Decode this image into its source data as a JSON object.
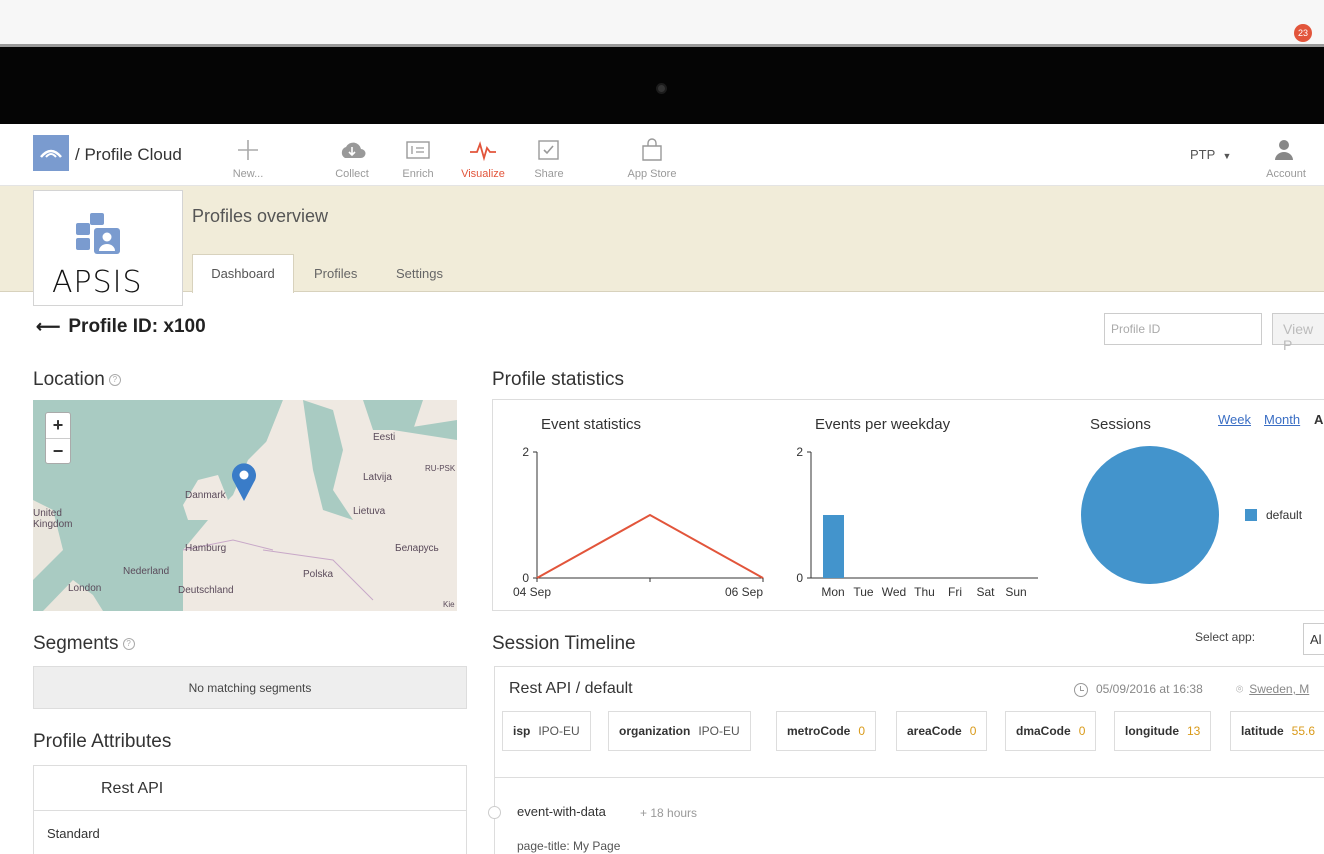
{
  "app": {
    "brand": "/ Profile Cloud",
    "apsis_word": "APSIS"
  },
  "toolbar": {
    "items": [
      {
        "label": "New...",
        "icon": "plus-icon"
      },
      {
        "label": "Collect",
        "icon": "cloud-icon"
      },
      {
        "label": "Enrich",
        "icon": "enrich-icon"
      },
      {
        "label": "Visualize",
        "icon": "pulse-icon"
      },
      {
        "label": "Share",
        "icon": "share-icon"
      },
      {
        "label": "App Store",
        "icon": "bag-icon"
      }
    ],
    "workspace": "PTP",
    "account_label": "Account",
    "account_badge": "23"
  },
  "header": {
    "title": "Profiles overview",
    "tabs": [
      "Dashboard",
      "Profiles",
      "Settings"
    ]
  },
  "profile": {
    "title": "Profile ID: x100",
    "search_placeholder": "Profile ID",
    "view_button": "View P"
  },
  "location": {
    "title": "Location",
    "zoom_in": "+",
    "zoom_out": "−",
    "labels": [
      "Eesti",
      "Latvija",
      "Lietuva",
      "Danmark",
      "Hamburg",
      "Nederland",
      "Deutschland",
      "Polska",
      "Беларусь",
      "London",
      "United Kingdom",
      "RU-PSK",
      "Kie"
    ]
  },
  "stats": {
    "title": "Profile statistics",
    "period_links": [
      "Week",
      "Month",
      "A"
    ],
    "event_stats_title": "Event statistics",
    "weekday_title": "Events per weekday",
    "sessions_title": "Sessions",
    "legend": "default"
  },
  "chart_data": [
    {
      "type": "line",
      "title": "Event statistics",
      "x": [
        "04 Sep",
        "05 Sep",
        "06 Sep"
      ],
      "y": [
        0,
        1,
        0
      ],
      "ylim": [
        0,
        2
      ],
      "xtick_labels": [
        "04 Sep",
        "06 Sep"
      ],
      "color": "#e2553b"
    },
    {
      "type": "bar",
      "title": "Events per weekday",
      "categories": [
        "Mon",
        "Tue",
        "Wed",
        "Thu",
        "Fri",
        "Sat",
        "Sun"
      ],
      "values": [
        1,
        0,
        0,
        0,
        0,
        0,
        0
      ],
      "ylim": [
        0,
        2
      ],
      "color": "#4394cc"
    },
    {
      "type": "pie",
      "title": "Sessions",
      "labels": [
        "default"
      ],
      "values": [
        1
      ],
      "color": "#4394cc",
      "legend": "right"
    }
  ],
  "segments": {
    "title": "Segments",
    "empty_text": "No matching segments"
  },
  "attributes": {
    "title": "Profile Attributes",
    "header": "Rest API",
    "first_row": "Standard"
  },
  "timeline": {
    "title": "Session Timeline",
    "select_label": "Select app:",
    "select_value": "Al",
    "session_title": "Rest API / default",
    "session_time": "05/09/2016 at 16:38",
    "session_location": "Sweden, M",
    "chips": [
      {
        "key": "isp",
        "value": "IPO-EU",
        "numeric": false
      },
      {
        "key": "organization",
        "value": "IPO-EU",
        "numeric": false
      },
      {
        "key": "metroCode",
        "value": "0",
        "numeric": true
      },
      {
        "key": "areaCode",
        "value": "0",
        "numeric": true
      },
      {
        "key": "dmaCode",
        "value": "0",
        "numeric": true
      },
      {
        "key": "longitude",
        "value": "13",
        "numeric": true
      },
      {
        "key": "latitude",
        "value": "55.6",
        "numeric": true
      }
    ],
    "event_name": "event-with-data",
    "event_time": "+ 18 hours",
    "event_data": "page-title: My Page"
  }
}
